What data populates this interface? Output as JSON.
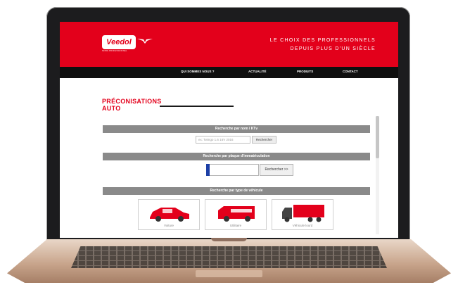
{
  "site": {
    "logo_text": "Veedol",
    "logo_subtext": "MOBIL PROFESSIONNEL",
    "tagline_line1": "LE CHOIX DES PROFESSIONNELS",
    "tagline_line2": "DEPUIS PLUS D'UN SIÈCLE"
  },
  "nav": {
    "items": [
      "QUI SOMMES NOUS ?",
      "ACTUALITÉ",
      "PRODUITS",
      "CONTACT"
    ]
  },
  "page": {
    "title_line1": "PRÉCONISATIONS",
    "title_line2": "AUTO"
  },
  "search_name": {
    "header": "Recherche par nom / KTv",
    "placeholder": "ex: Twingo 1.6 16V 2016",
    "button": "Rechercher"
  },
  "search_plate": {
    "header": "Recherche par plaque d'immatriculation",
    "button": "Rechercher >>"
  },
  "search_type": {
    "header": "Recherche par type de véhicule",
    "cards": [
      "Voiture",
      "Utilitaire",
      "Véhicule lourd"
    ]
  },
  "colors": {
    "brand_red": "#e3001b",
    "nav_black": "#0f0f0f",
    "section_gray": "#8a8a8a"
  }
}
